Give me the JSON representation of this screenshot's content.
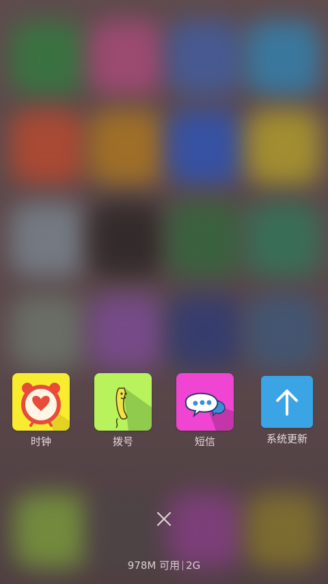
{
  "recent_apps": [
    {
      "label": "时钟",
      "icon": "alarm-clock-icon",
      "color": "#f7ec2f"
    },
    {
      "label": "拨号",
      "icon": "phone-handset-icon",
      "color": "#b8f25c"
    },
    {
      "label": "短信",
      "icon": "chat-bubbles-icon",
      "color": "#ef45d2"
    },
    {
      "label": "系统更新",
      "icon": "arrow-up-icon",
      "color": "#3aa4e4"
    }
  ],
  "close_icon": "close-icon",
  "memory": {
    "available": "978M 可用",
    "total": "2G"
  }
}
